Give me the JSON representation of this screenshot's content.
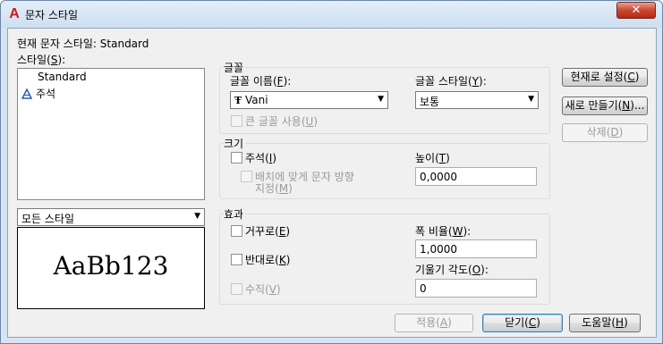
{
  "window": {
    "title": "문자 스타일",
    "close_label": "✕"
  },
  "current_style": {
    "label": "현재 문자 스타일:",
    "value": "Standard"
  },
  "styles": {
    "label": "스타일(",
    "mnemonic": "S",
    "label_end": "):",
    "items": [
      {
        "name": "Standard",
        "icon": "none"
      },
      {
        "name": "주석",
        "icon": "annotative-icon"
      }
    ],
    "filter": "모든 스타일"
  },
  "preview": {
    "text": "AaBb123"
  },
  "font": {
    "group_label": "글꼴",
    "name_label": "글꼴 이름(",
    "name_mnemonic": "F",
    "name_end": "):",
    "name_value": "Vani",
    "style_label": "글꼴 스타일(",
    "style_mnemonic": "Y",
    "style_end": "):",
    "style_value": "보통",
    "bigfont_label": "큰 글꼴 사용(",
    "bigfont_mnemonic": "U",
    "bigfont_end": ")"
  },
  "size": {
    "group_label": "크기",
    "annotative_label": "주석(",
    "annotative_mnemonic": "I",
    "annotative_end": ")",
    "match_line1": "배치에 맞게 문자 방향",
    "match_line2": "지정(",
    "match_mnemonic": "M",
    "match_end": ")",
    "height_label": "높이(",
    "height_mnemonic": "T",
    "height_end": ")",
    "height_value": "0,0000"
  },
  "effects": {
    "group_label": "효과",
    "upside_label": "거꾸로(",
    "upside_mnemonic": "E",
    "upside_end": ")",
    "backwards_label": "반대로(",
    "backwards_mnemonic": "K",
    "backwards_end": ")",
    "vertical_label": "수직(",
    "vertical_mnemonic": "V",
    "vertical_end": ")",
    "width_label": "폭 비율(",
    "width_mnemonic": "W",
    "width_end": "):",
    "width_value": "1,0000",
    "oblique_label": "기울기 각도(",
    "oblique_mnemonic": "O",
    "oblique_end": "):",
    "oblique_value": "0"
  },
  "buttons": {
    "set_current": {
      "label": "현재로 설정(",
      "mnemonic": "C",
      "end": ")"
    },
    "new": {
      "label": "새로 만들기(",
      "mnemonic": "N",
      "end": ")..."
    },
    "delete": {
      "label": "삭제(",
      "mnemonic": "D",
      "end": ")"
    },
    "apply": {
      "label": "적용(",
      "mnemonic": "A",
      "end": ")"
    },
    "close": {
      "label": "닫기(",
      "mnemonic": "C",
      "end": ")"
    },
    "help": {
      "label": "도움말(",
      "mnemonic": "H",
      "end": ")"
    }
  }
}
